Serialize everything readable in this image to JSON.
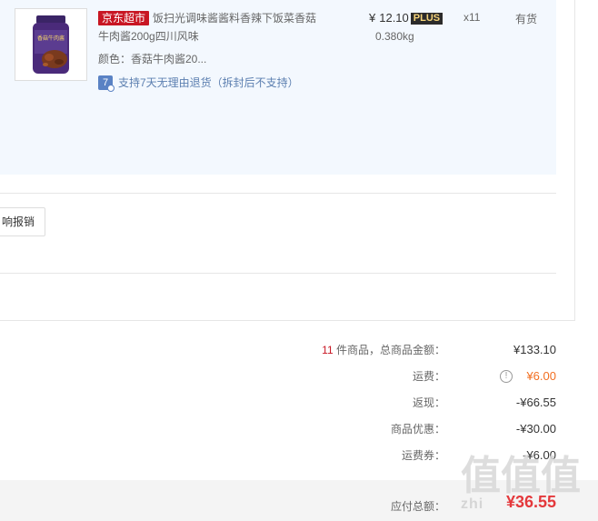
{
  "product": {
    "store_tag": "京东超市",
    "title": "饭扫光调味酱酱料香辣下饭菜香菇牛肉酱200g四川风味",
    "spec_label": "颜色：香菇牛肉酱20...",
    "returns_note": "支持7天无理由退货（拆封后不支持）",
    "returns_icon": "7",
    "price_symbol": "¥",
    "price": "12.10",
    "plus_badge": "PLUS",
    "weight": "0.380kg",
    "quantity": "x11",
    "stock": "有货",
    "image_caption": "香菇牛肉酱"
  },
  "invoice_button": "响报销",
  "summary": {
    "count": "11",
    "count_label": "件商品，总商品金额：",
    "goods_total": "¥133.10",
    "shipping_label": "运费：",
    "shipping_info_icon": "!",
    "shipping": "¥6.00",
    "cashback_label": "返现：",
    "cashback": "-¥66.55",
    "discount_label": "商品优惠：",
    "discount": "-¥30.00",
    "coupon_label": "运费券：",
    "coupon": "-¥6.00"
  },
  "total": {
    "label": "应付总额：",
    "amount": "¥36.55"
  },
  "watermark": {
    "glyphs": "值值值",
    "text": "zhi"
  },
  "colors": {
    "accent_red": "#c81623",
    "total_red": "#e4393c",
    "fee_orange": "#f26f21",
    "panel_bg": "#f3f8fe",
    "link_blue": "#5c7fb0"
  }
}
